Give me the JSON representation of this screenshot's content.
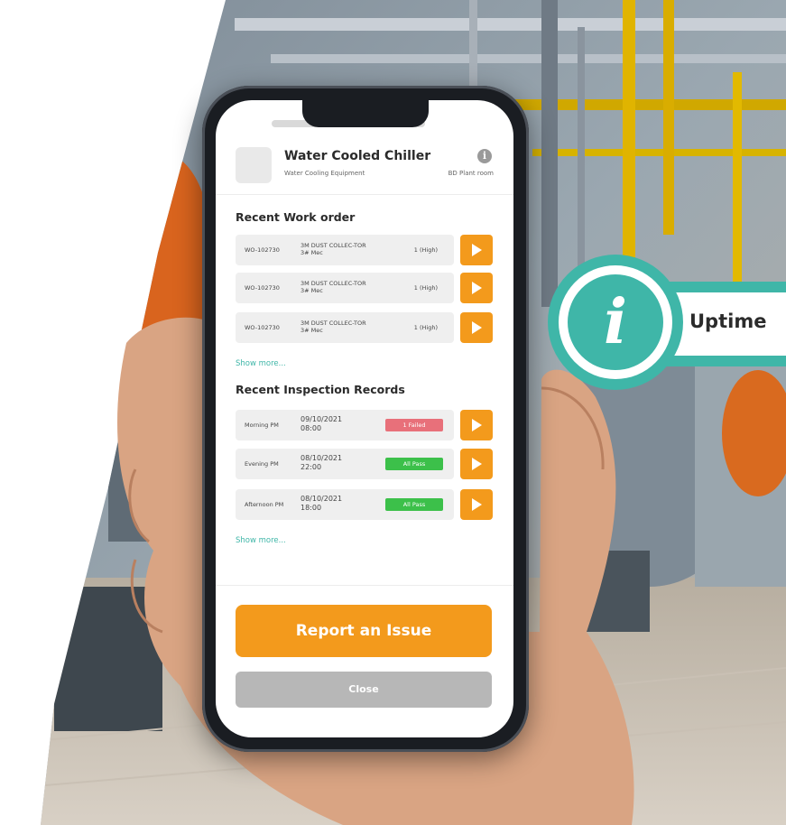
{
  "equipment": {
    "title": "Water Cooled Chiller",
    "category": "Water Cooling Equipment",
    "location": "BD Plant room",
    "info_icon": "info-icon"
  },
  "work_orders": {
    "title": "Recent Work order",
    "rows": [
      {
        "id": "WO-102730",
        "desc": "3M DUST COLLEC-TOR 3# Mec",
        "priority": "1 (High)"
      },
      {
        "id": "WO-102730",
        "desc": "3M DUST COLLEC-TOR 3# Mec",
        "priority": "1 (High)"
      },
      {
        "id": "WO-102730",
        "desc": "3M DUST COLLEC-TOR 3# Mec",
        "priority": "1 (High)"
      }
    ],
    "show_more": "Show more..."
  },
  "inspections": {
    "title": "Recent Inspection Records",
    "rows": [
      {
        "name": "Morning PM",
        "date": "09/10/2021",
        "time": "08:00",
        "status": "1 Failed",
        "status_color": "#e8707a"
      },
      {
        "name": "Evening PM",
        "date": "08/10/2021",
        "time": "22:00",
        "status": "All Pass",
        "status_color": "#3cc04a"
      },
      {
        "name": "Afternoon PM",
        "date": "08/10/2021",
        "time": "18:00",
        "status": "All Pass",
        "status_color": "#3cc04a"
      }
    ],
    "show_more": "Show more..."
  },
  "actions": {
    "report_label": "Report an Issue",
    "close_label": "Close"
  },
  "callout": {
    "label": "Uptime",
    "icon": "info-icon"
  },
  "colors": {
    "accent_orange": "#f39a1c",
    "teal": "#3fb6a8",
    "fail_red": "#e8707a",
    "pass_green": "#3cc04a"
  }
}
